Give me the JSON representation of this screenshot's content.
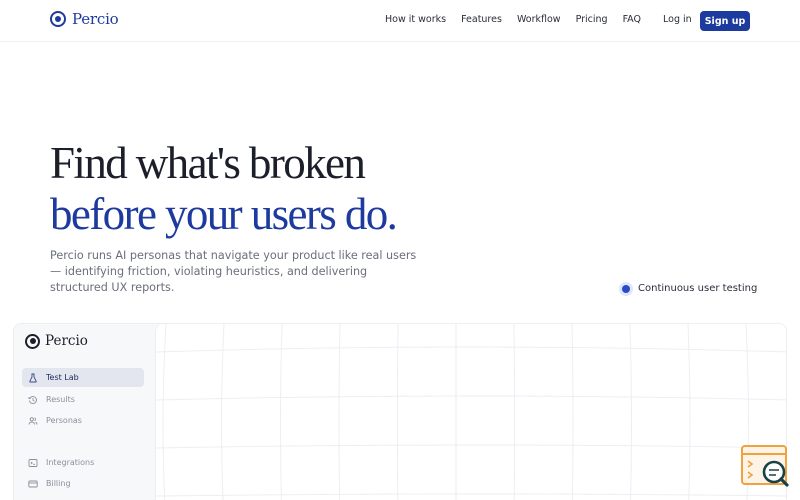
{
  "nav": {
    "brand": "Percio",
    "links": [
      "How it works",
      "Features",
      "Workflow",
      "Pricing",
      "FAQ"
    ],
    "login": "Log in",
    "signup": "Sign up"
  },
  "hero": {
    "line1": "Find what's broken",
    "line2": "before your users do.",
    "subtitle_lines": [
      "Percio runs AI personas that navigate your product like real users",
      "— identifying friction, violating heuristics, and delivering",
      "structured UX reports."
    ],
    "badge": "Continuous user testing"
  },
  "app": {
    "brand": "Percio",
    "sidebar": [
      {
        "label": "Test Lab",
        "icon": "flask-icon",
        "active": true
      },
      {
        "label": "Results",
        "icon": "history-icon",
        "active": false
      },
      {
        "label": "Personas",
        "icon": "users-icon",
        "active": false
      },
      {
        "label": "Integrations",
        "icon": "integrations-icon",
        "active": false
      },
      {
        "label": "Billing",
        "icon": "credit-card-icon",
        "active": false
      }
    ]
  },
  "colors": {
    "accent": "#1d3a9e",
    "widget": "#f0a33c",
    "widget_dark": "#16424a"
  }
}
